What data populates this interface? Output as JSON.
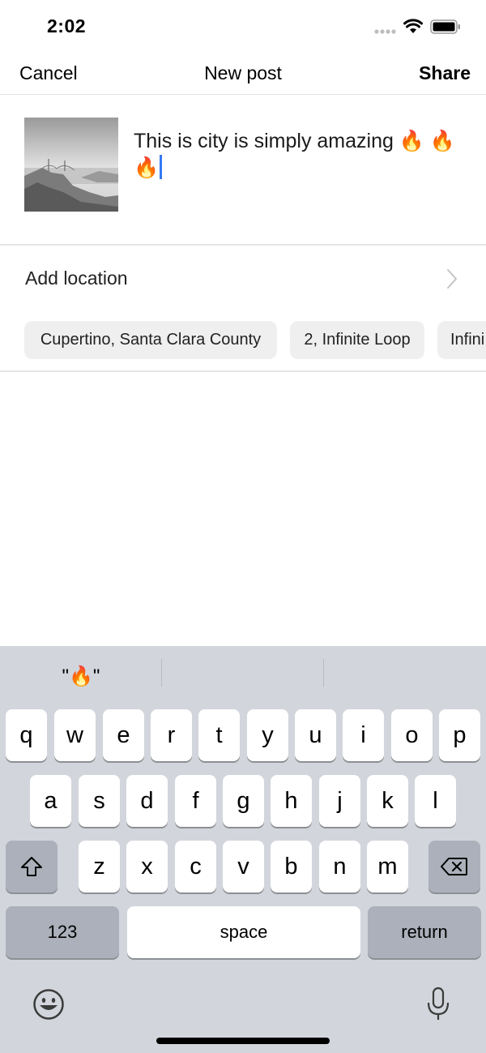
{
  "status_bar": {
    "time": "2:02"
  },
  "nav": {
    "cancel_label": "Cancel",
    "title": "New post",
    "share_label": "Share"
  },
  "compose": {
    "caption": "This is city is simply amazing 🔥 🔥 🔥",
    "image_icon": "golden-gate-landscape-photo"
  },
  "location": {
    "label": "Add location",
    "suggestions": [
      "Cupertino, Santa Clara County",
      "2, Infinite Loop",
      "Infini"
    ]
  },
  "keyboard": {
    "suggestions": [
      "\"🔥\"",
      "",
      ""
    ],
    "rows": [
      [
        "q",
        "w",
        "e",
        "r",
        "t",
        "y",
        "u",
        "i",
        "o",
        "p"
      ],
      [
        "a",
        "s",
        "d",
        "f",
        "g",
        "h",
        "j",
        "k",
        "l"
      ],
      [
        "z",
        "x",
        "c",
        "v",
        "b",
        "n",
        "m"
      ]
    ],
    "numbers_label": "123",
    "space_label": "space",
    "return_label": "return",
    "icons": [
      "shift-icon",
      "delete-icon",
      "emoji-icon",
      "microphone-icon"
    ]
  },
  "colors": {
    "cursor": "#3478f6",
    "keyboard_bg": "#d2d5db",
    "chip_bg": "#efefef"
  }
}
